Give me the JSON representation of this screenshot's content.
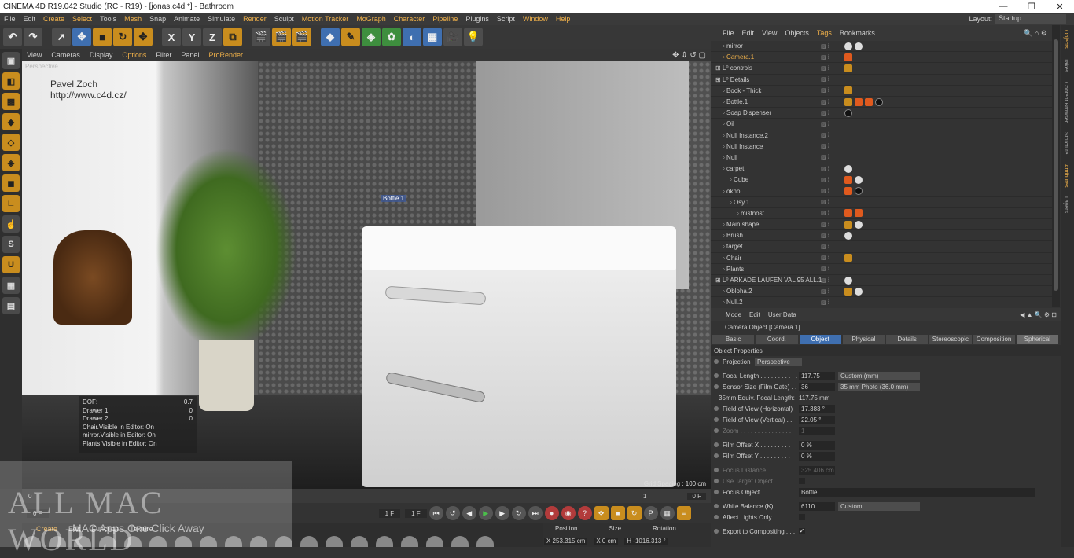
{
  "titlebar": {
    "title": "CINEMA 4D R19.042 Studio (RC - R19) - [jonas.c4d *] - Bathroom",
    "min": "—",
    "max": "❐",
    "close": "✕"
  },
  "menu": [
    "File",
    "Edit",
    "Create",
    "Select",
    "Tools",
    "Mesh",
    "Snap",
    "Animate",
    "Simulate",
    "Render",
    "Sculpt",
    "Motion Tracker",
    "MoGraph",
    "Character",
    "Pipeline",
    "Plugins",
    "Script",
    "Window",
    "Help"
  ],
  "layout": {
    "label": "Layout:",
    "value": "Startup"
  },
  "toolbar_icons": [
    "undo-icon",
    "redo-icon",
    "live-selection-icon",
    "move-icon",
    "scale-icon",
    "rotate-icon",
    "transform-icon",
    "x-axis-icon",
    "y-axis-icon",
    "z-axis-icon",
    "coordinate-system-icon",
    "render-view-icon",
    "render-picture-icon",
    "render-settings-icon",
    "cube-icon",
    "pen-icon",
    "subdivision-icon",
    "cloner-icon",
    "deformer-icon",
    "floor-icon",
    "camera-icon",
    "light-icon"
  ],
  "toolbar_glyphs": [
    "↶",
    "↷",
    "➚",
    "✥",
    "■",
    "↻",
    "✥",
    "X",
    "Y",
    "Z",
    "⧉",
    "🎬",
    "🎬",
    "🎬",
    "◆",
    "✎",
    "◈",
    "✿",
    "◐",
    "▦",
    "🎥",
    "💡"
  ],
  "viewport": {
    "menu": [
      "View",
      "Cameras",
      "Display",
      "Options",
      "Filter",
      "Panel",
      "ProRender"
    ],
    "nav_icons": "✥ ⇕ ↺ ▢",
    "perspective": "Perspective",
    "credit_name": "Pavel Zoch",
    "credit_url": "http://www.c4d.cz/",
    "selected_label": "Bottle.1",
    "hud": [
      {
        "label": "DOF:",
        "value": "0.7"
      },
      {
        "label": "Drawer 1:",
        "value": "0"
      },
      {
        "label": "Drawer 2:",
        "value": "0"
      }
    ],
    "hud_lines": [
      "Chair.Visible in Editor: On",
      "mirror.Visible in Editor: On",
      "Plants.Visible in Editor: On"
    ],
    "grid_spacing": "Grid Spacing : 100 cm"
  },
  "timeline": {
    "ticks": [
      "0",
      "1"
    ],
    "current": "0 F"
  },
  "transport": {
    "start": "0 F",
    "mid": "1 F",
    "end": "1 F"
  },
  "matbar": {
    "menu": [
      "Create",
      "Edit",
      "Function",
      "Texture"
    ]
  },
  "coords": {
    "headers": [
      "Position",
      "Size",
      "Rotation"
    ],
    "values": [
      "X  253.315 cm",
      "X  0 cm",
      "H  -1016.313 °"
    ]
  },
  "objects": {
    "menu": [
      "File",
      "Edit",
      "View",
      "Objects",
      "Tags",
      "Bookmarks"
    ],
    "active_menu": "Tags",
    "rows": [
      {
        "name": "mirror",
        "level": 1,
        "hl": false
      },
      {
        "name": "Camera.1",
        "level": 1,
        "hl": true
      },
      {
        "name": "controls",
        "level": 0,
        "hl": false
      },
      {
        "name": "Details",
        "level": 0,
        "hl": false
      },
      {
        "name": "Book - Thick",
        "level": 1,
        "hl": false
      },
      {
        "name": "Bottle.1",
        "level": 1,
        "hl": false
      },
      {
        "name": "Soap Dispenser",
        "level": 1,
        "hl": false
      },
      {
        "name": "Oil",
        "level": 1,
        "hl": false
      },
      {
        "name": "Null Instance.2",
        "level": 1,
        "hl": false
      },
      {
        "name": "Null Instance",
        "level": 1,
        "hl": false
      },
      {
        "name": "Null",
        "level": 1,
        "hl": false
      },
      {
        "name": "carpet",
        "level": 1,
        "hl": false
      },
      {
        "name": "Cube",
        "level": 2,
        "hl": false
      },
      {
        "name": "okno",
        "level": 1,
        "hl": false
      },
      {
        "name": "Osy.1",
        "level": 2,
        "hl": false
      },
      {
        "name": "mistnost",
        "level": 3,
        "hl": false
      },
      {
        "name": "Main shape",
        "level": 1,
        "hl": false
      },
      {
        "name": "Brush",
        "level": 1,
        "hl": false
      },
      {
        "name": "target",
        "level": 1,
        "hl": false
      },
      {
        "name": "Chair",
        "level": 1,
        "hl": false
      },
      {
        "name": "Plants",
        "level": 1,
        "hl": false
      },
      {
        "name": "ARKADE LAUFEN  VAL 95 ALL.1",
        "level": 0,
        "hl": false
      },
      {
        "name": "Obloha.2",
        "level": 1,
        "hl": false
      },
      {
        "name": "Null.2",
        "level": 1,
        "hl": false
      }
    ]
  },
  "sidetabs": [
    "Objects",
    "Takes",
    "Content Browser",
    "Structure",
    "Attributes",
    "Layers"
  ],
  "attributes": {
    "menu": [
      "Mode",
      "Edit",
      "User Data"
    ],
    "object_title": "Camera Object [Camera.1]",
    "tabs": [
      "Basic",
      "Coord.",
      "Object",
      "Physical",
      "Details",
      "Stereoscopic",
      "Composition",
      "Spherical"
    ],
    "active_tab": "Object",
    "section": "Object Properties",
    "projection_label": "Projection",
    "projection_value": "Perspective",
    "focal_length_label": "Focal Length . . . . . . . . . . .",
    "focal_length": "117.75",
    "focal_length_preset": "Custom (mm)",
    "sensor_label": "Sensor Size (Film Gate) . .",
    "sensor": "36",
    "sensor_preset": "35 mm Photo (36.0 mm)",
    "equiv_label": "35mm Equiv. Focal Length:",
    "equiv": "117.75 mm",
    "fovh_label": "Field of View (Horizontal)",
    "fovh": "17.383 °",
    "fovv_label": "Field of View (Vertical) . .",
    "fovv": "22.05 °",
    "zoom_label": "Zoom . . . . . . . . . . . . . . .",
    "zoom": "1",
    "offx_label": "Film Offset X . . . . . . . . .",
    "offx": "0 %",
    "offy_label": "Film Offset Y . . . . . . . . .",
    "offy": "0 %",
    "focus_dist_label": "Focus Distance . . . . . . . .",
    "focus_dist": "325.406 cm",
    "use_target_label": "Use Target Object . . . . . .",
    "focus_obj_label": "Focus Object . . . . . . . . . .",
    "focus_obj": "Bottle",
    "wb_label": "White Balance (K) . . . . . .",
    "wb": "6110",
    "wb_preset": "Custom",
    "affect_label": "Affect Lights Only . . . . . .",
    "export_label": "Export to Compositing . . .",
    "export_check": "✓"
  },
  "watermark": {
    "big": "ALL MAC WORLD",
    "small": "MAC Apps One Click Away"
  }
}
